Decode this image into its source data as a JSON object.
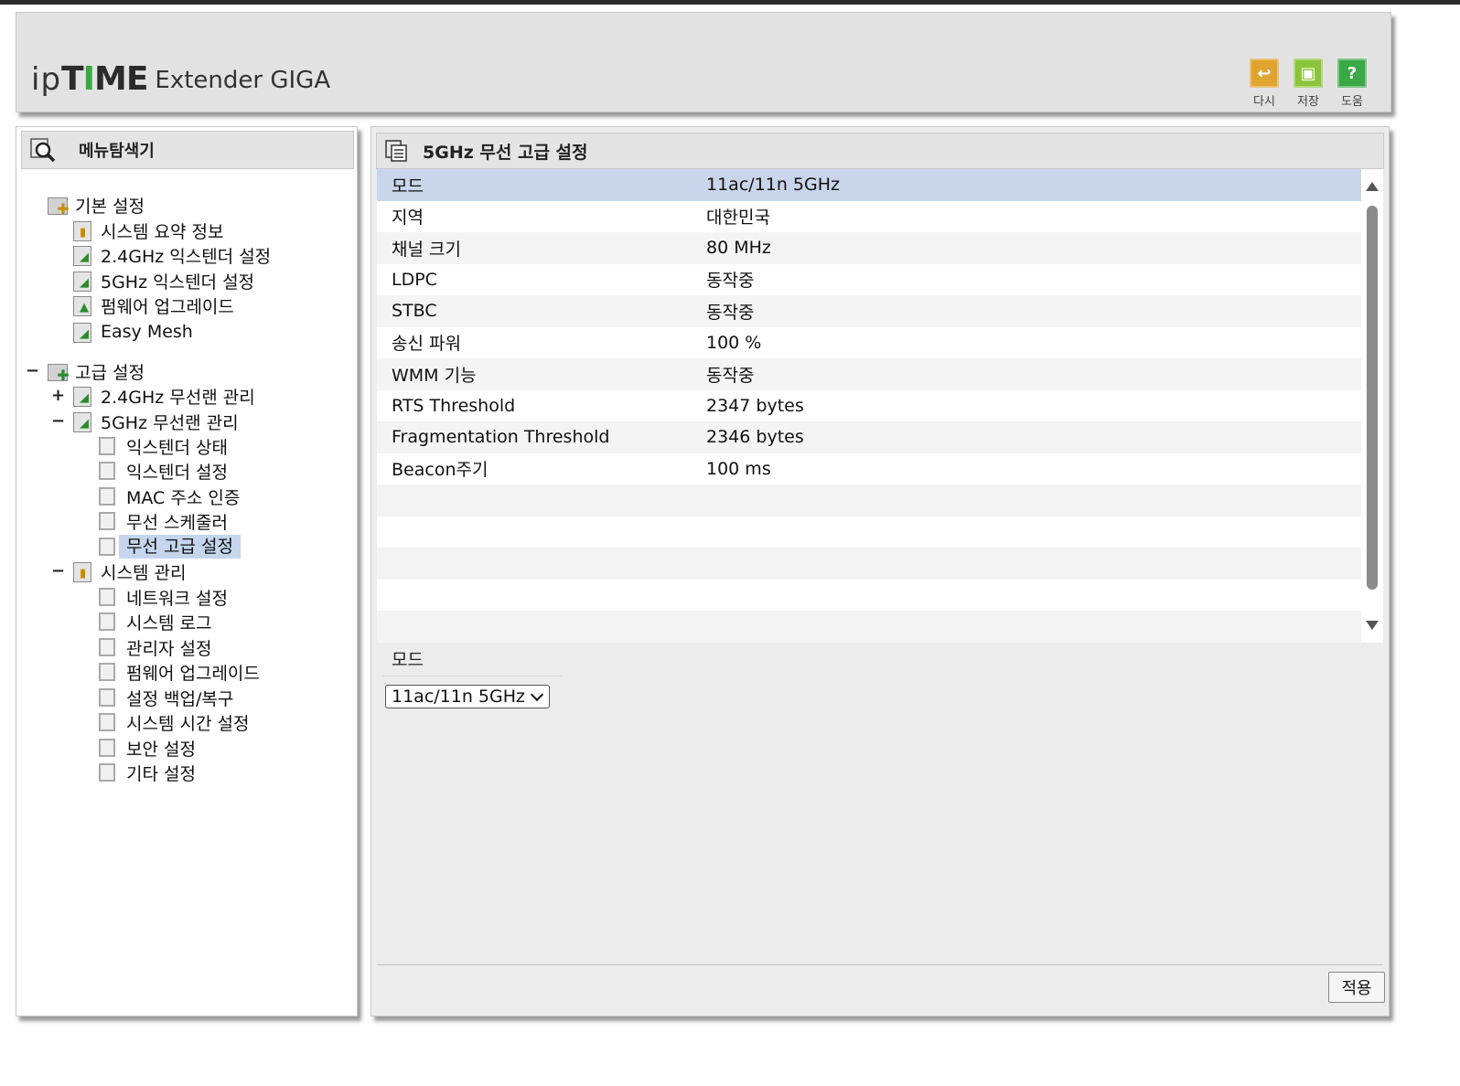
{
  "header": {
    "logo_ip": "ip",
    "logo_time_a": "T",
    "logo_time_i": "I",
    "logo_time_b": "ME",
    "logo_product": "Extender GIGA",
    "tools": [
      {
        "label": "다시",
        "icon": "reload-icon",
        "color": "#e0a431",
        "glyph": "↩"
      },
      {
        "label": "저장",
        "icon": "save-icon",
        "color": "#8cc43c",
        "glyph": "▣"
      },
      {
        "label": "도움",
        "icon": "help-icon",
        "color": "#3aa845",
        "glyph": "?"
      }
    ]
  },
  "sidebar": {
    "title": "메뉴탐색기",
    "basic": {
      "label": "기본 설정",
      "items": [
        "시스템 요약 정보",
        "2.4GHz 익스텐더 설정",
        "5GHz 익스텐더 설정",
        "펌웨어 업그레이드",
        "Easy Mesh"
      ]
    },
    "advanced": {
      "label": "고급 설정",
      "toggle": "−",
      "wlan24": {
        "label": "2.4GHz 무선랜 관리",
        "toggle": "+"
      },
      "wlan5": {
        "label": "5GHz 무선랜 관리",
        "toggle": "−",
        "items": [
          "익스텐더 상태",
          "익스텐더 설정",
          "MAC 주소 인증",
          "무선 스케줄러",
          "무선 고급 설정"
        ]
      },
      "system": {
        "label": "시스템 관리",
        "toggle": "−",
        "items": [
          "네트워크 설정",
          "시스템 로그",
          "관리자 설정",
          "펌웨어 업그레이드",
          "설정 백업/복구",
          "시스템 시간 설정",
          "보안 설정",
          "기타 설정"
        ]
      }
    }
  },
  "main": {
    "title": "5GHz 무선 고급 설정",
    "rows": [
      {
        "k": "모드",
        "v": "11ac/11n 5GHz"
      },
      {
        "k": "지역",
        "v": "대한민국"
      },
      {
        "k": "채널 크기",
        "v": "80 MHz"
      },
      {
        "k": "LDPC",
        "v": "동작중"
      },
      {
        "k": "STBC",
        "v": "동작중"
      },
      {
        "k": "송신 파워",
        "v": "100 %"
      },
      {
        "k": "WMM 기능",
        "v": "동작중"
      },
      {
        "k": "RTS Threshold",
        "v": "2347 bytes"
      },
      {
        "k": "Fragmentation Threshold",
        "v": "2346 bytes"
      },
      {
        "k": "Beacon주기",
        "v": "100 ms"
      }
    ],
    "edit_label": "모드",
    "select_value": "11ac/11n 5GHz",
    "apply_label": "적용"
  },
  "colors": {
    "selected_row": "#c8d5ea",
    "tree_selected": "#c4d5ec",
    "header_bg": "#e2e2e2"
  }
}
